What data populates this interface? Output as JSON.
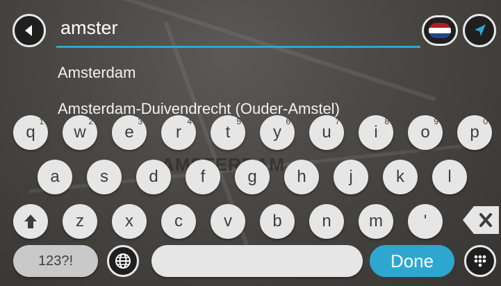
{
  "search": {
    "query": "amster"
  },
  "results": [
    {
      "label": "Amsterdam"
    },
    {
      "label": "Amsterdam-Duivendrecht (Ouder-Amstel)"
    }
  ],
  "map": {
    "label": "AMSTERDAM"
  },
  "keyboard": {
    "row1": [
      {
        "key": "q",
        "sup": "1"
      },
      {
        "key": "w",
        "sup": "2"
      },
      {
        "key": "e",
        "sup": "3"
      },
      {
        "key": "r",
        "sup": "4"
      },
      {
        "key": "t",
        "sup": "5"
      },
      {
        "key": "y",
        "sup": "6"
      },
      {
        "key": "u",
        "sup": "7"
      },
      {
        "key": "i",
        "sup": "8"
      },
      {
        "key": "o",
        "sup": "9"
      },
      {
        "key": "p",
        "sup": "0"
      }
    ],
    "row2": [
      "a",
      "s",
      "d",
      "f",
      "g",
      "h",
      "j",
      "k",
      "l"
    ],
    "row3": [
      "z",
      "x",
      "c",
      "v",
      "b",
      "n",
      "m",
      "'"
    ],
    "numbers_label": "123?!",
    "done_label": "Done"
  },
  "colors": {
    "accent": "#2ea7d0",
    "key": "#e6e6e6",
    "dark": "#1f1f1f"
  },
  "icons": {
    "back": "back-arrow-icon",
    "flag": "netherlands-flag-icon",
    "nav": "navigation-arrow-icon",
    "shift": "shift-arrow-icon",
    "globe": "globe-icon",
    "backspace": "backspace-icon",
    "keypad": "keypad-icon"
  }
}
